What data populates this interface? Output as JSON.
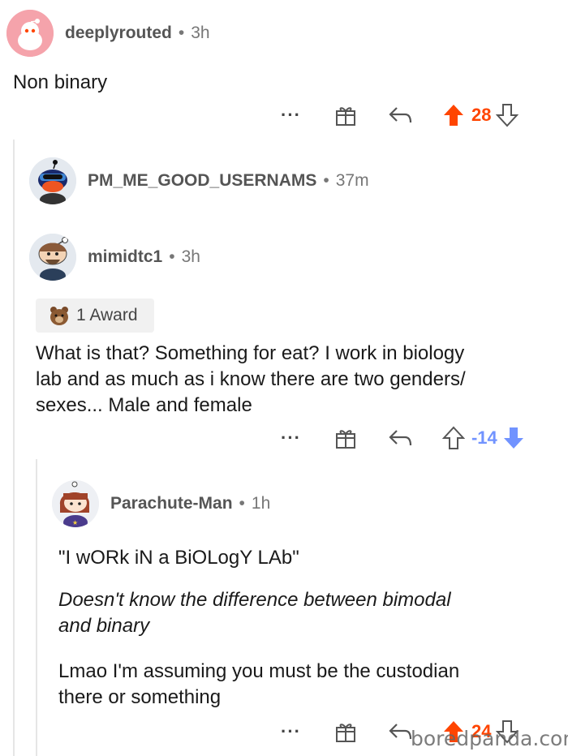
{
  "comments": [
    {
      "username": "deeplyrouted",
      "time": "3h",
      "body": "Non binary",
      "score": "28"
    },
    {
      "username": "PM_ME_GOOD_USERNAMS",
      "time": "37m"
    },
    {
      "username": "mimidtc1",
      "time": "3h",
      "award": "1 Award",
      "body_lines": [
        "What is that? Something for eat? I work in biology",
        "lab and as much as i know there are two genders/",
        "sexes... Male and female"
      ],
      "score": "-14"
    },
    {
      "username": "ParachuteMan",
      "display_username": "Parachute-Man",
      "time": "1h",
      "paragraphs": [
        "\"I wORk iN a BiOLogY LAb\"",
        "Doesn't know the difference between bimodal and binary",
        "Lmao I'm assuming you must be the custodian there or something"
      ],
      "para_lines": [
        [
          "\"I wORk iN a BiOLogY LAb\""
        ],
        [
          "Doesn't know the difference between bimodal",
          "and binary"
        ],
        [
          "Lmao I'm assuming you must be the custodian",
          "there or something"
        ]
      ],
      "score": "24"
    }
  ],
  "separator": "•",
  "more_label": "···",
  "watermark": "boredpanda.com",
  "colors": {
    "upvote": "#ff4500",
    "downvote": "#7193ff",
    "meta": "#777777"
  },
  "icons": [
    "more-icon",
    "gift-icon",
    "reply-icon",
    "upvote-arrow-icon",
    "downvote-arrow-icon",
    "award-bear-icon"
  ]
}
